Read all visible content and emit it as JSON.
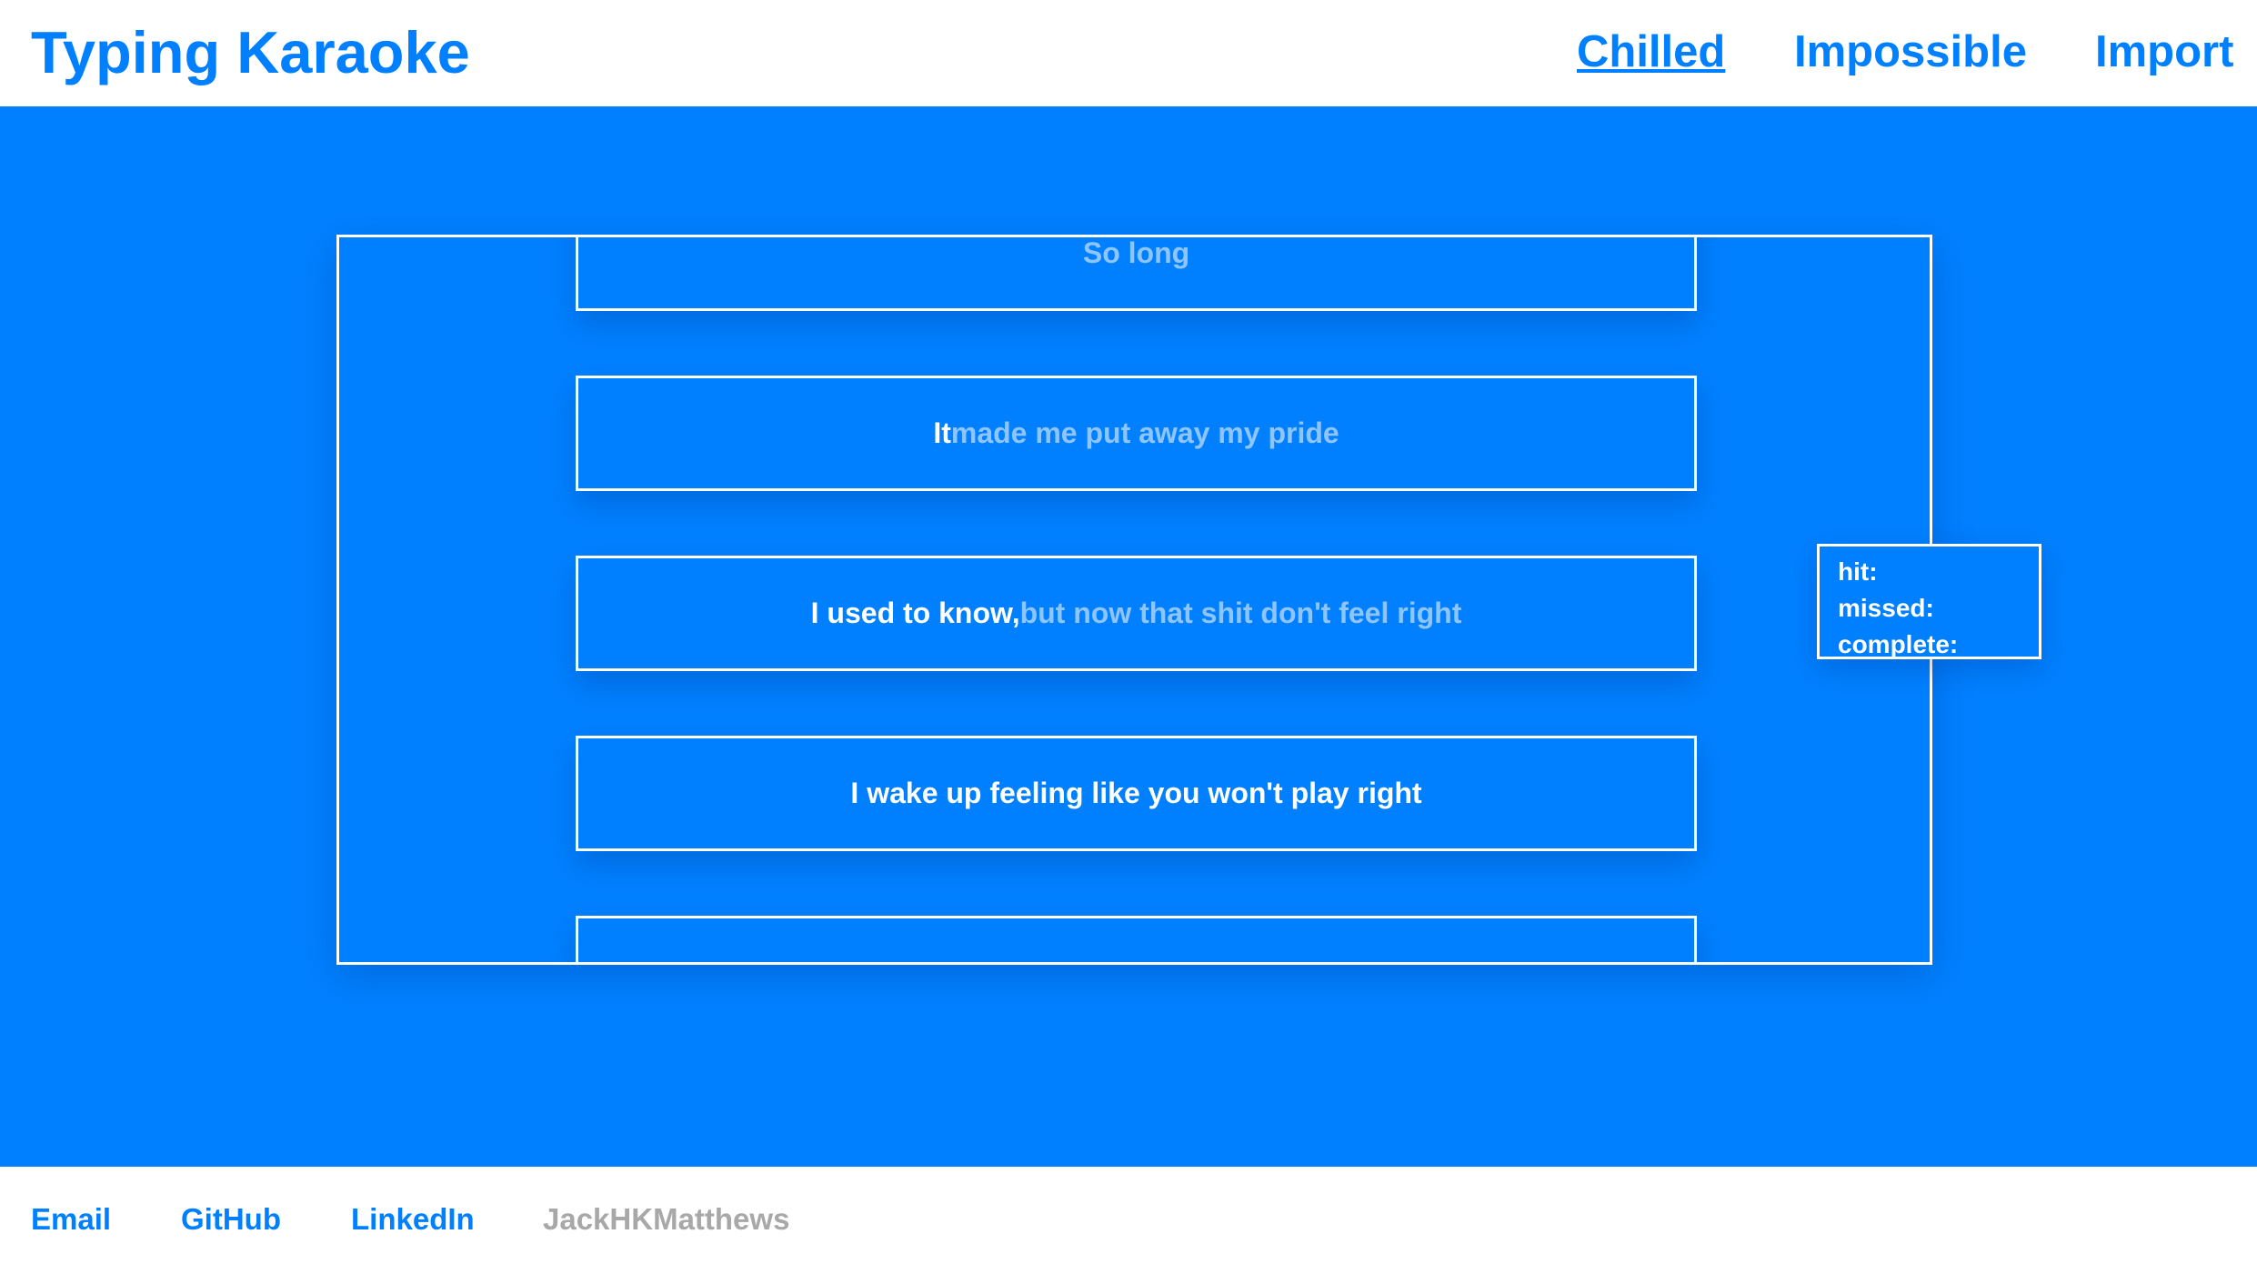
{
  "header": {
    "title": "Typing Karaoke",
    "nav": {
      "chilled": "Chilled",
      "impossible": "Impossible",
      "import": "Import"
    }
  },
  "lyrics": [
    {
      "typed": "",
      "pending": "So long"
    },
    {
      "typed": "It",
      "pending": " made me put away my pride"
    },
    {
      "typed": "I used to know,",
      "pending": " but now that shit don't feel right"
    },
    {
      "typed": "I wake up feeling like you won't play right",
      "pending": ""
    },
    {
      "typed": "",
      "pending": ""
    }
  ],
  "stats": {
    "hit_label": "hit:",
    "missed_label": "missed:",
    "complete_label": "complete:"
  },
  "footer": {
    "email": "Email",
    "github": "GitHub",
    "linkedin": "LinkedIn",
    "author": "JackHKMatthews"
  },
  "colors": {
    "accent": "#0080ff",
    "line_border": "#ffffff",
    "pending_text": "#8ec5ff",
    "author_text": "#a8a8a8"
  }
}
